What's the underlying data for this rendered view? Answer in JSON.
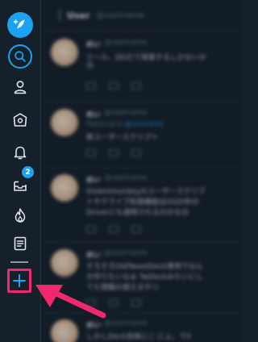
{
  "sidebar": {
    "compose_icon": "feather-plus-icon",
    "search_icon": "search-icon",
    "profile_icon": "user-icon",
    "home_icon": "home-icon",
    "notifications_icon": "bell-icon",
    "messages_icon": "inbox-icon",
    "messages_badge": "2",
    "trending_icon": "flame-icon",
    "lists_icon": "list-icon",
    "add_column_icon": "plus-icon",
    "accent_color": "#1da1f2",
    "highlight_color": "#f0296e"
  },
  "column": {
    "header_user": "User",
    "header_handle": "@username",
    "tweets": [
      {
        "name": "めい",
        "handle": "@username",
        "reply_to": "",
        "reply_handle": "",
        "lines": [
          "ツール、DGだで用意するしかないか",
          "😊"
        ]
      },
      {
        "name": "めい",
        "handle": "@username",
        "reply_to": "Replying to",
        "reply_handle": "@username",
        "lines": [
          "新ユーザースクリプト"
        ]
      },
      {
        "name": "めい",
        "handle": "@username",
        "reply_to": "",
        "reply_handle": "",
        "lines": [
          "Violentmonkeyのユーザースクリプ",
          "トやクライブ拡張機能は2020年の",
          "Driverにも適用されるのかな😊"
        ]
      },
      {
        "name": "めい",
        "handle": "@username",
        "reply_to": "",
        "reply_handle": "",
        "lines": [
          "そろそろOldTweetDeck専用でなん",
          "か作りたいなぁ TwDeckみたいにし",
          "てた情報の使えるやつ"
        ]
      },
      {
        "name": "めい",
        "handle": "@username",
        "reply_to": "",
        "reply_handle": "",
        "lines": [
          "しかしDeck自体にこ にょ。で5"
        ]
      }
    ]
  },
  "annotation": {
    "arrow_color": "#f0296e"
  }
}
